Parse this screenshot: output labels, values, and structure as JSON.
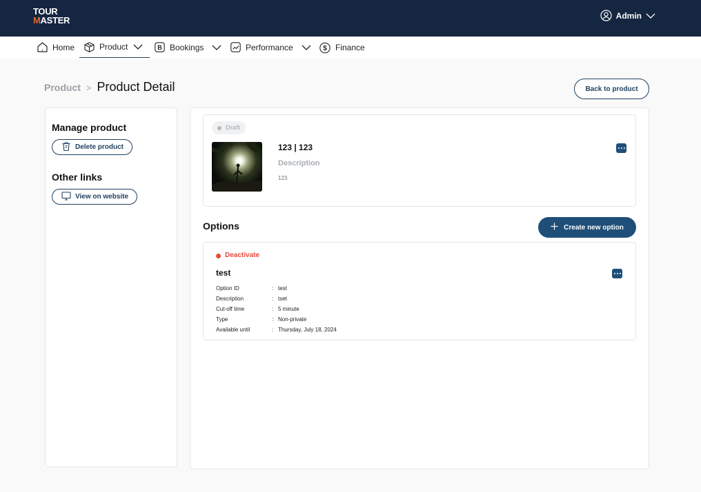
{
  "app": {
    "logo_top": "TOUR",
    "logo_bottom_accent": "M",
    "logo_bottom": "ASTER",
    "user_name": "Admin"
  },
  "nav": {
    "items": [
      {
        "label": "Home",
        "icon": "home-icon",
        "dropdown": false
      },
      {
        "label": "Product",
        "icon": "box-icon",
        "dropdown": true,
        "active": true
      },
      {
        "label": "Bookings",
        "icon": "bookings-icon",
        "dropdown": true
      },
      {
        "label": "Performance",
        "icon": "chart-icon",
        "dropdown": true
      },
      {
        "label": "Finance",
        "icon": "dollar-icon",
        "dropdown": false
      }
    ]
  },
  "breadcrumb": {
    "root": "Product",
    "separator": ">",
    "current": "Product Detail"
  },
  "header": {
    "back_button": "Back to product"
  },
  "sidebar": {
    "manage_title": "Manage product",
    "delete_button": "Delete product",
    "links_title": "Other links",
    "view_button": "View on website"
  },
  "product": {
    "status": "Draft",
    "name": "123 | 123",
    "description_label": "Description",
    "description": "123"
  },
  "options": {
    "title": "Options",
    "create_button": "Create new option",
    "items": [
      {
        "status": "Deactivate",
        "name": "test",
        "fields": [
          {
            "key": "Option ID",
            "colon": ":",
            "value": "test"
          },
          {
            "key": "Description",
            "colon": ":",
            "value": "tset"
          },
          {
            "key": "Cut-off time",
            "colon": ":",
            "value": "5 minute"
          },
          {
            "key": "Type",
            "colon": ":",
            "value": "Non-private"
          },
          {
            "key": "Available until",
            "colon": ":",
            "value": "Thursday, July 18, 2024"
          }
        ]
      }
    ]
  },
  "colors": {
    "topbar": "#152640",
    "primary": "#1f4f78",
    "accent_logo": "#e8632c",
    "deactivate": "#e54b3c",
    "draft": "#b4b8bd"
  }
}
